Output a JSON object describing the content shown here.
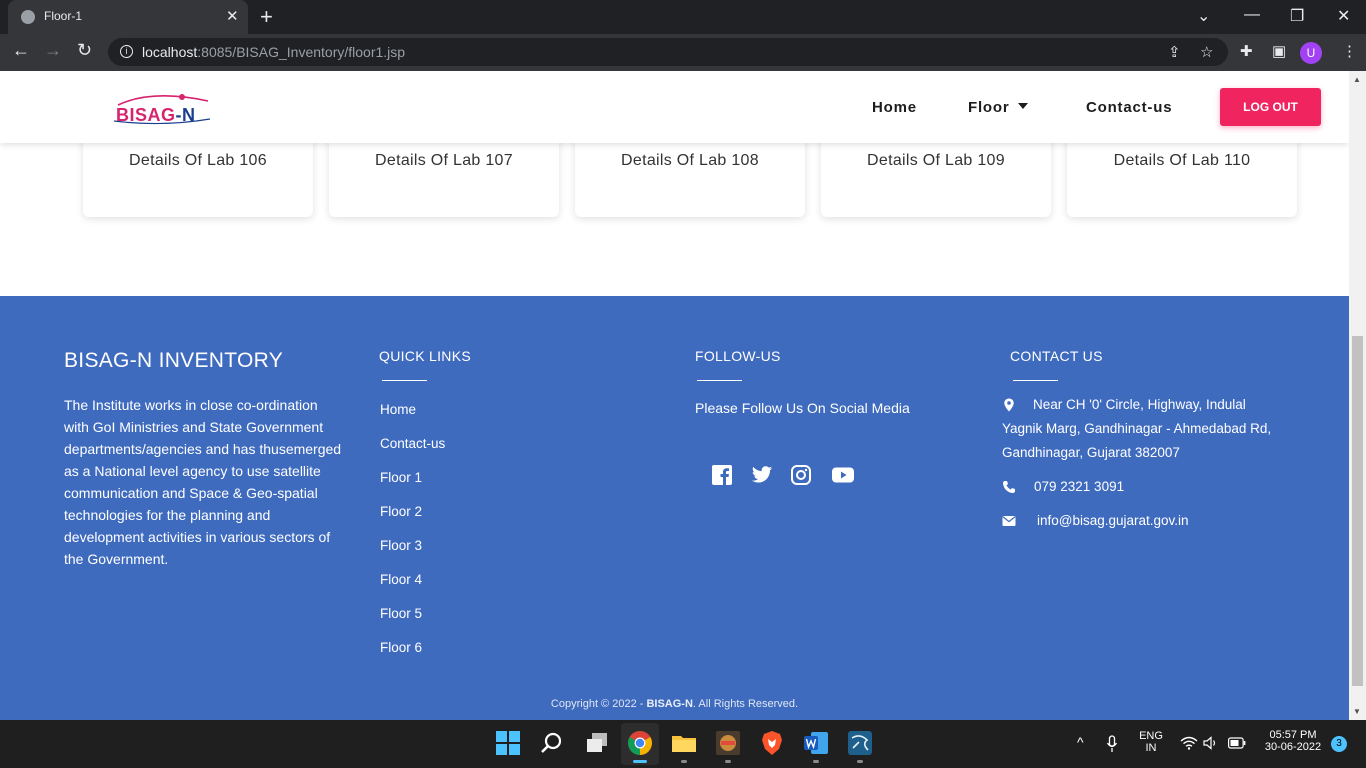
{
  "browser": {
    "tab_title": "Floor-1",
    "url_host": "localhost",
    "url_rest": ":8085/BISAG_Inventory/floor1.jsp",
    "profile_initial": "U"
  },
  "header": {
    "logo_text_a": "BISAG",
    "logo_text_b": "-N",
    "nav": [
      "Home",
      "Floor",
      "Contact-us"
    ],
    "logout_label": "LOG OUT"
  },
  "labs": [
    "Details Of Lab 106",
    "Details Of Lab 107",
    "Details Of Lab 108",
    "Details Of Lab 109",
    "Details Of Lab 110"
  ],
  "footer": {
    "brand": "BISAG-N INVENTORY",
    "description": "The Institute works in close co-ordination with GoI Ministries and State Government departments/agencies and has thusemerged as a National level agency to use satellite communication and Space & Geo-spatial technologies for the planning and development activities in various sectors of the Government.",
    "quick_links_title": "QUICK LINKS",
    "quick_links": [
      "Home",
      "Contact-us",
      "Floor 1",
      "Floor 2",
      "Floor 3",
      "Floor 4",
      "Floor 5",
      "Floor 6"
    ],
    "follow_title": "FOLLOW-US",
    "follow_text": "Please Follow Us On Social Media",
    "social_icons": [
      "facebook-icon",
      "twitter-icon",
      "instagram-icon",
      "youtube-icon"
    ],
    "contact_title": "CONTACT US",
    "address_line1": "Near CH '0' Circle, Highway, Indulal",
    "address_line2": "Yagnik Marg, Gandhinagar - Ahmedabad Rd,",
    "address_line3": "Gandhinagar, Gujarat 382007",
    "phone": "079 2321 3091",
    "email": "info@bisag.gujarat.gov.in",
    "copyright_prefix": "Copyright © 2022 - ",
    "copyright_brand": "BISAG-N",
    "copyright_suffix": ". All Rights Reserved."
  },
  "colors": {
    "footer_bg": "#3f6bbf",
    "logout_bg": "#f0245e"
  },
  "taskbar": {
    "lang_line1": "ENG",
    "lang_line2": "IN",
    "time": "05:57 PM",
    "date": "30-06-2022",
    "notification_count": "3"
  }
}
